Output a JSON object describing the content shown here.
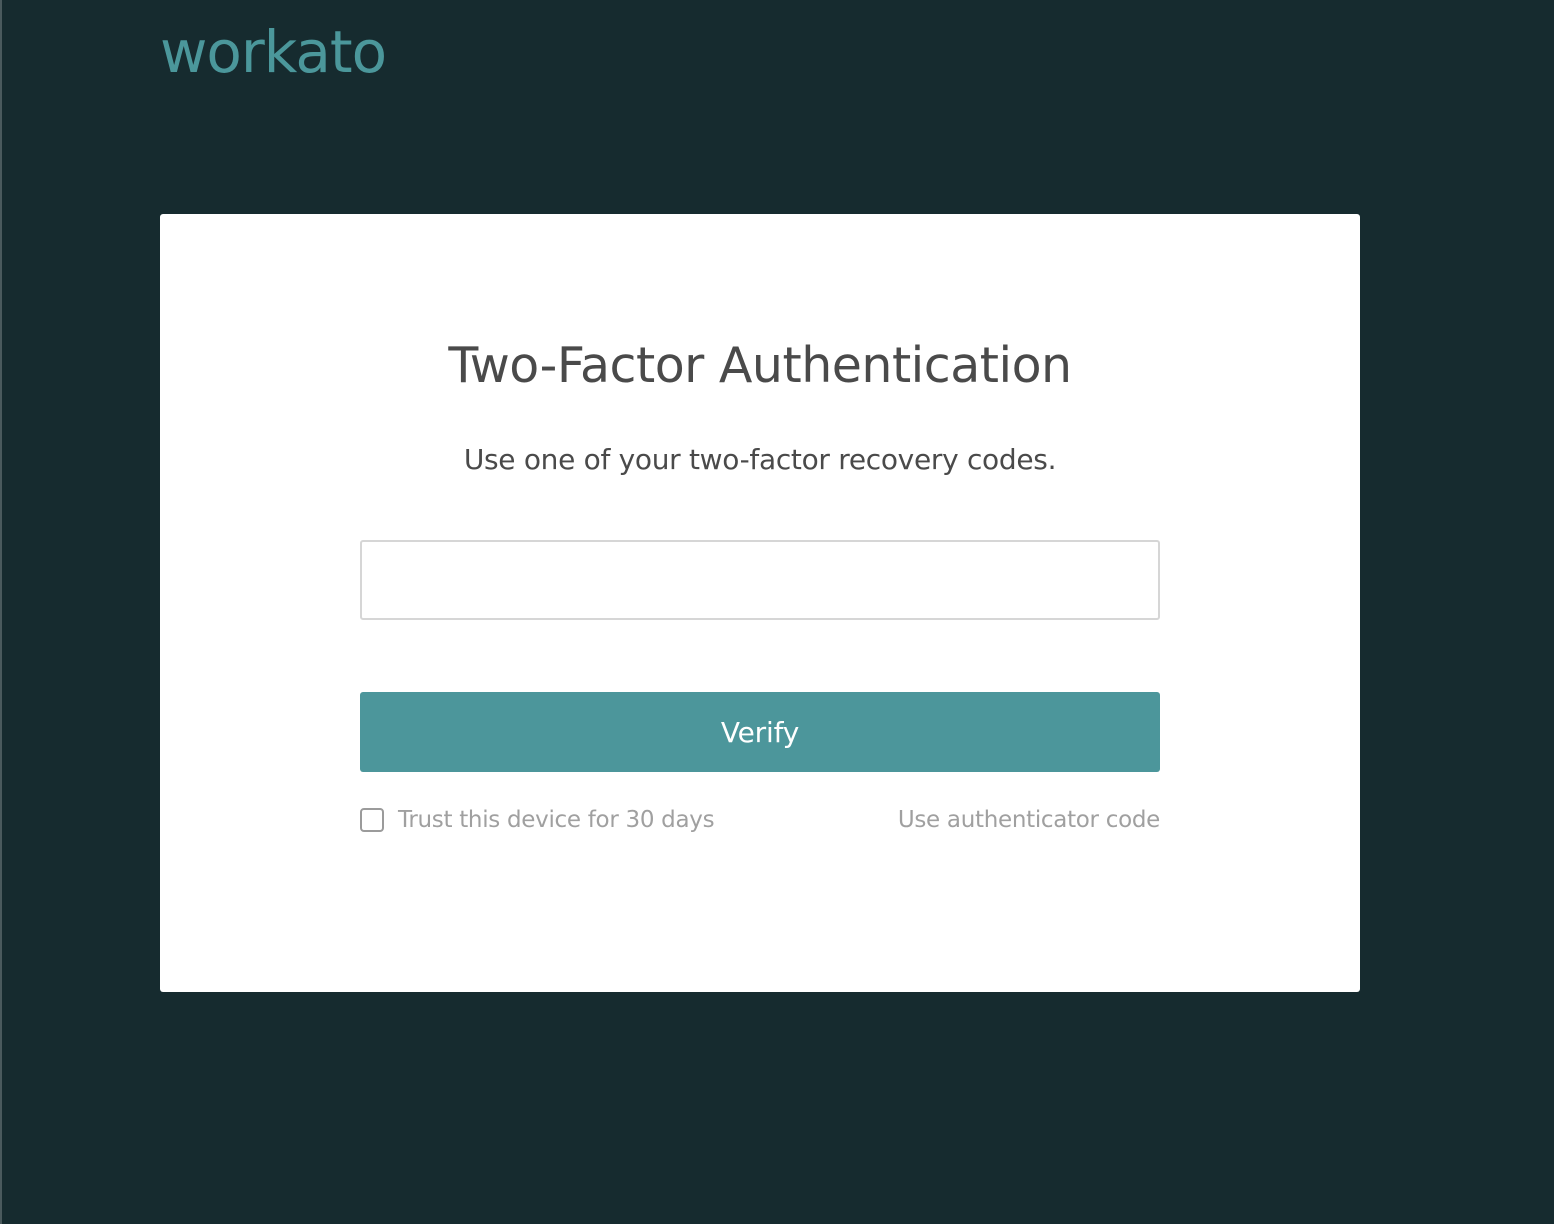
{
  "brand": {
    "logo_text": "workato",
    "accent_color": "#4b979b",
    "background_color": "#162b2f"
  },
  "card": {
    "title": "Two-Factor Authentication",
    "subtitle": "Use one of your two-factor recovery codes.",
    "code_input": {
      "value": "",
      "placeholder": ""
    },
    "verify_label": "Verify",
    "trust_device": {
      "label": "Trust this device for 30 days",
      "checked": false
    },
    "alt_method_link": "Use authenticator code"
  }
}
